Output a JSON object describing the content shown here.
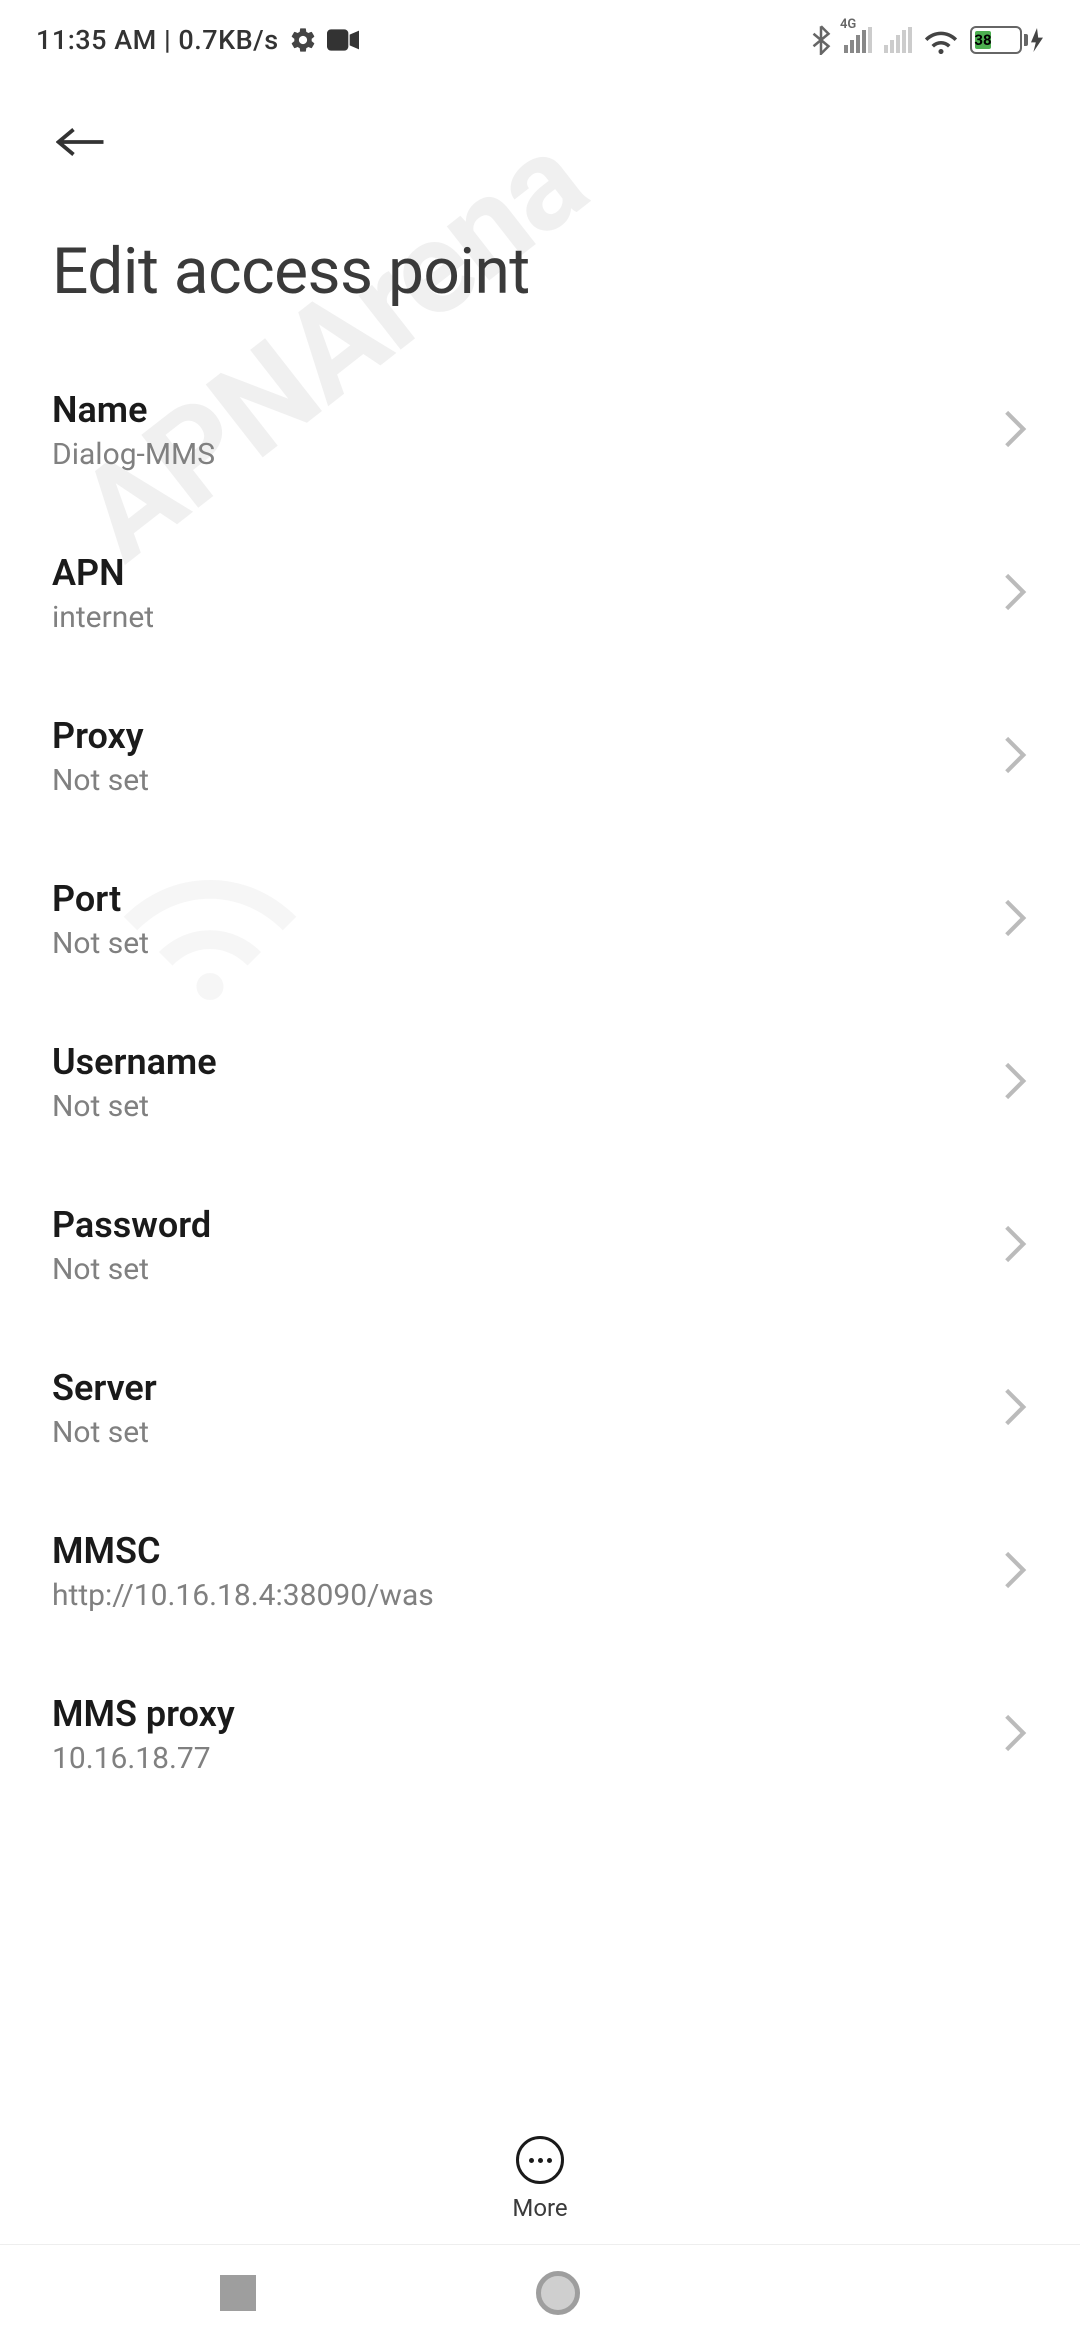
{
  "status_bar": {
    "time": "11:35 AM",
    "separator": " | ",
    "data_rate": "0.7KB/s",
    "network_label": "4G",
    "battery_percent": "38"
  },
  "header": {
    "title": "Edit access point"
  },
  "settings": [
    {
      "label": "Name",
      "value": "Dialog-MMS"
    },
    {
      "label": "APN",
      "value": "internet"
    },
    {
      "label": "Proxy",
      "value": "Not set"
    },
    {
      "label": "Port",
      "value": "Not set"
    },
    {
      "label": "Username",
      "value": "Not set"
    },
    {
      "label": "Password",
      "value": "Not set"
    },
    {
      "label": "Server",
      "value": "Not set"
    },
    {
      "label": "MMSC",
      "value": "http://10.16.18.4:38090/was"
    },
    {
      "label": "MMS proxy",
      "value": "10.16.18.77"
    }
  ],
  "bottom_bar": {
    "more_label": "More"
  },
  "watermark_text": "APNArena"
}
